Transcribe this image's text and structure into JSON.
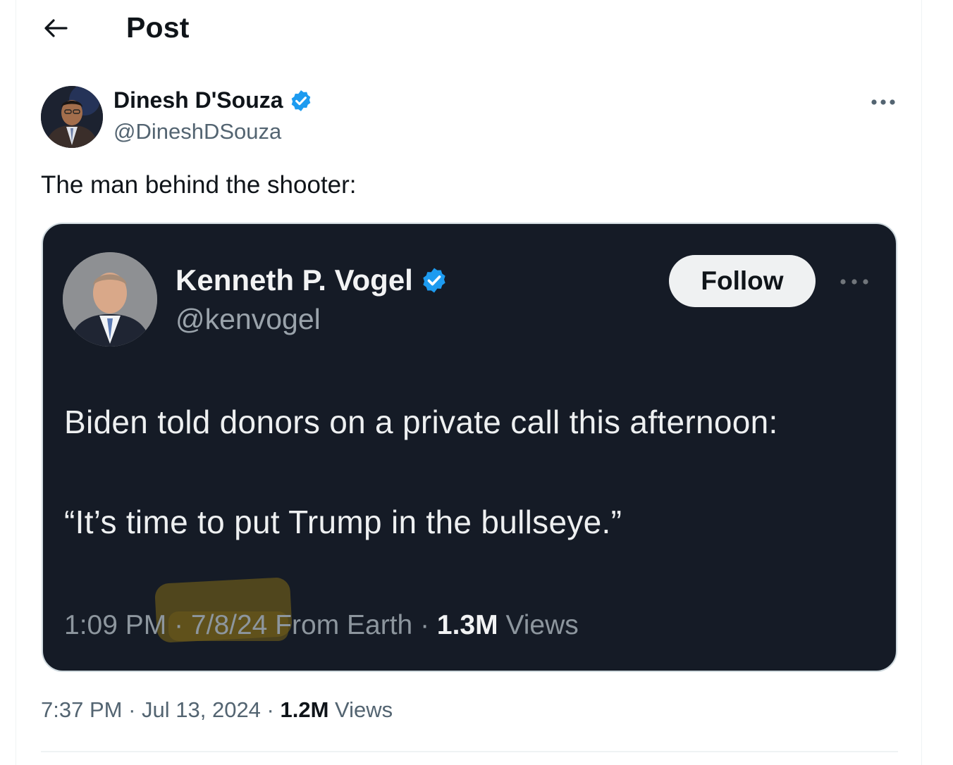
{
  "header": {
    "back_icon": "arrow-left-icon",
    "title": "Post"
  },
  "post": {
    "author": {
      "name": "Dinesh D'Souza",
      "handle": "@DineshDSouza",
      "verified_icon": "verified-badge-icon",
      "verified_color": "#1d9bf0"
    },
    "more_icon": "more-horizontal-icon",
    "text": "The man behind the shooter:",
    "embedded_screenshot": {
      "author": {
        "name": "Kenneth P. Vogel",
        "handle": "@kenvogel",
        "verified_icon": "verified-badge-icon"
      },
      "follow_label": "Follow",
      "more_icon": "more-horizontal-icon",
      "line1": "Biden told donors on a private call this afternoon:",
      "line2": "“It’s time to put Trump in the bullseye.”",
      "meta": {
        "time": "1:09 PM",
        "sep1": " · ",
        "date": "7/8/24",
        "location": " From Earth",
        "sep2": " · ",
        "views_count": "1.3M",
        "views_label": " Views"
      },
      "background": "#151b26"
    },
    "meta": {
      "time": "7:37 PM",
      "sep1": " · ",
      "date": "Jul 13, 2024",
      "sep2": " · ",
      "views_count": "1.2M",
      "views_label": " Views"
    }
  }
}
